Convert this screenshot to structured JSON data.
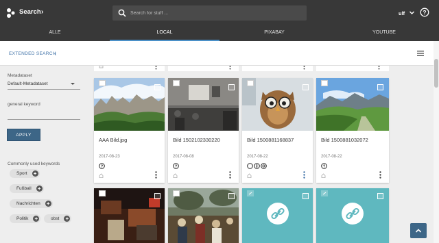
{
  "header": {
    "app_title": "Search",
    "search_placeholder": "Search for stuff ...",
    "user": "ulf"
  },
  "tabs": [
    {
      "label": "ALLE",
      "active": false
    },
    {
      "label": "LOCAL",
      "active": true
    },
    {
      "label": "PIXABAY",
      "active": false
    },
    {
      "label": "YOUTUBE",
      "active": false
    }
  ],
  "subbar": {
    "extended_search_label": "EXTENDED SEARCH"
  },
  "sidebar": {
    "metadataset_label": "Metadataset",
    "metadataset_value": "Default-Metadataset",
    "keyword_label": "general keyword",
    "apply_label": "APPLY",
    "common_keywords_label": "Commonly used keywords",
    "keywords": [
      "Sport",
      "Fußball",
      "Nachrichten",
      "Politik",
      "obst"
    ]
  },
  "cards": [
    {
      "title": "AAA Bild.jpg",
      "date": "2017-08-23",
      "license": "help-circle-icon"
    },
    {
      "title": "Bild 1502102330220",
      "date": "2017-08-08",
      "license": "help-circle-icon"
    },
    {
      "title": "Bild 1500881168837",
      "date": "2017-08-22",
      "license": "creative-commons-icons"
    },
    {
      "title": "Bild 1500881032072",
      "date": "2017-08-22",
      "license": "help-circle-icon"
    }
  ],
  "colors": {
    "topbar": "#383838",
    "accent": "#3d6687",
    "link": "#3a6ea5",
    "tile_teal": "#5fb8bf"
  }
}
